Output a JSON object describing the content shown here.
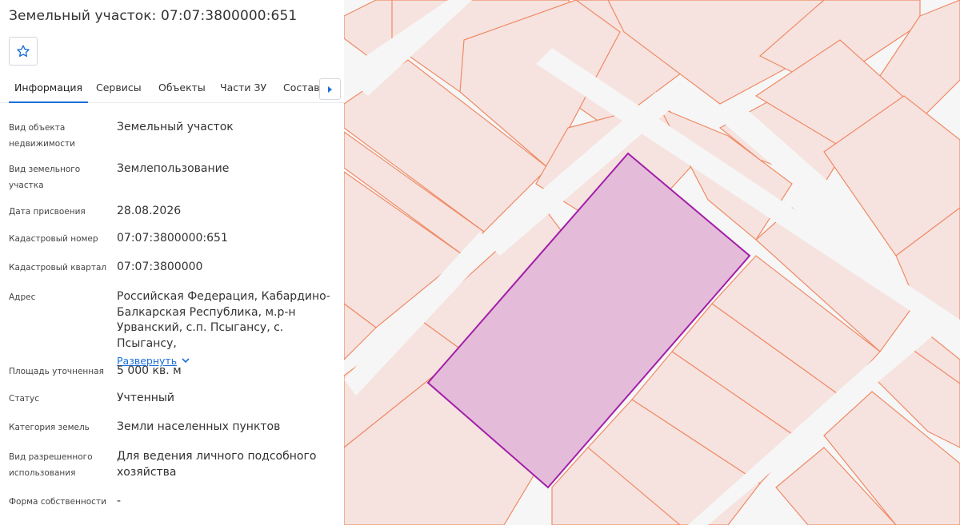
{
  "header": {
    "title": "Земельный участок: 07:07:3800000:651"
  },
  "favorite": {
    "icon": "star-outline-icon"
  },
  "tabs": [
    {
      "label": "Информация",
      "active": true
    },
    {
      "label": "Сервисы",
      "active": false
    },
    {
      "label": "Объекты",
      "active": false
    },
    {
      "label": "Части ЗУ",
      "active": false
    },
    {
      "label": "Состав",
      "active": false
    }
  ],
  "tabs_next_icon": "caret-right-icon",
  "info": {
    "object_type": {
      "label": "Вид объекта недвижимости",
      "value": "Земельный участок"
    },
    "parcel_type": {
      "label": "Вид земельного участка",
      "value": "Землепользование"
    },
    "assigned_date": {
      "label": "Дата присвоения",
      "value": "28.08.2026"
    },
    "cadastral_number": {
      "label": "Кадастровый номер",
      "value": "07:07:3800000:651"
    },
    "cadastral_quarter": {
      "label": "Кадастровый квартал",
      "value": "07:07:3800000"
    },
    "address": {
      "label": "Адрес",
      "value": "Российская Федерация, Кабардино-Балкарская Республика, м.р-н Урванский, с.п. Псыгансу, с. Псыгансу,",
      "expand_label": "Развернуть"
    },
    "area": {
      "label": "Площадь уточненная",
      "value": "5 000 кв. м"
    },
    "status": {
      "label": "Статус",
      "value": "Учтенный"
    },
    "land_category": {
      "label": "Категория земель",
      "value": "Земли населенных пунктов"
    },
    "permitted_use": {
      "label": "Вид разрешенного использования",
      "value": "Для ведения личного подсобного хозяйства"
    },
    "ownership": {
      "label": "Форма собственности",
      "value": "-"
    }
  },
  "map": {
    "parcel_fill": "#f6e3df",
    "parcel_stroke": "#ef8a66",
    "selected_fill": "#e4bcda",
    "selected_stroke": "#a21ea8",
    "road_color": "#f6f6f6"
  }
}
